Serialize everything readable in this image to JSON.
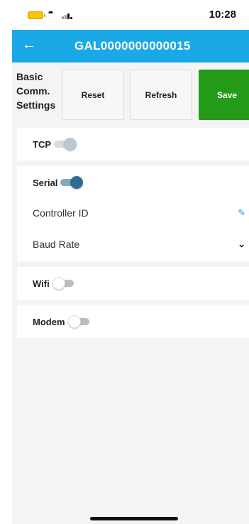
{
  "status_bar": {
    "time": "10:28",
    "battery_icon": "battery-icon",
    "wifi_icon": "wifi-icon",
    "signal_icon": "signal-icon"
  },
  "header": {
    "back_icon": "back-arrow-icon",
    "title": "GAL0000000000015",
    "background_color": "#1aa8e6"
  },
  "toolbar": {
    "section_label": "Basic Comm. Settings",
    "reset_label": "Reset",
    "refresh_label": "Refresh",
    "save_label": "Save",
    "save_color": "#239b19"
  },
  "connections": {
    "tcp": {
      "label": "TCP",
      "state": "on-disabled"
    },
    "serial": {
      "label": "Serial",
      "state": "on",
      "fields": {
        "controller_id_label": "Controller ID",
        "controller_id_icon": "pencil-icon",
        "baud_rate_label": "Baud Rate",
        "baud_rate_icon": "chevron-down-icon"
      }
    },
    "wifi": {
      "label": "Wifi",
      "state": "off"
    },
    "modem": {
      "label": "Modem",
      "state": "off"
    }
  }
}
